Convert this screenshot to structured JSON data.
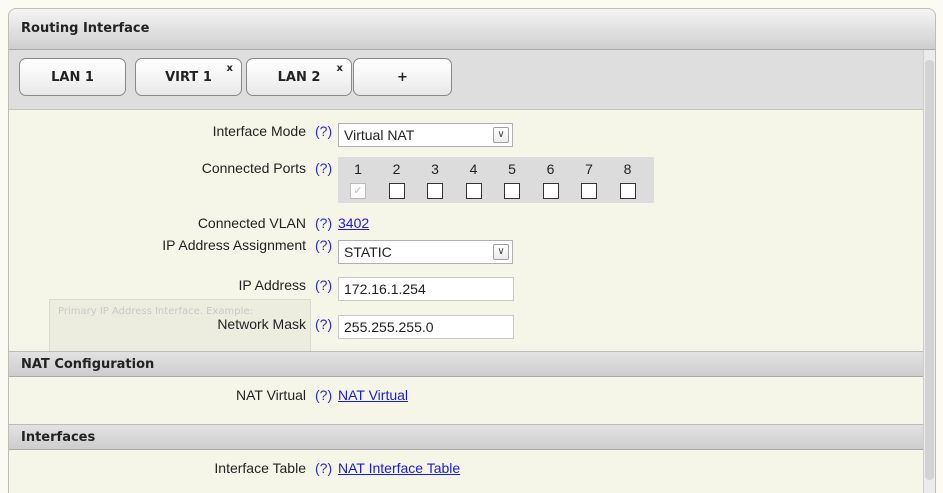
{
  "panel": {
    "title": "Routing Interface"
  },
  "tabs": [
    {
      "label": "LAN 1",
      "close": ""
    },
    {
      "label": "VIRT 1",
      "close": "x"
    },
    {
      "label": "LAN 2",
      "close": "x"
    },
    {
      "label": "+",
      "close": ""
    }
  ],
  "form": {
    "help": "(?)",
    "interface_mode": {
      "label": "Interface Mode",
      "value": "Virtual NAT",
      "arrow": "∨"
    },
    "connected_ports": {
      "label": "Connected Ports",
      "ports": [
        {
          "num": "1",
          "checked": true
        },
        {
          "num": "2",
          "checked": false
        },
        {
          "num": "3",
          "checked": false
        },
        {
          "num": "4",
          "checked": false
        },
        {
          "num": "5",
          "checked": false
        },
        {
          "num": "6",
          "checked": false
        },
        {
          "num": "7",
          "checked": false
        },
        {
          "num": "8",
          "checked": false
        }
      ]
    },
    "connected_vlan": {
      "label": "Connected VLAN",
      "value": "3402"
    },
    "ip_assignment": {
      "label": "IP Address Assignment",
      "value": "STATIC",
      "arrow": "∨"
    },
    "ip_address": {
      "label": "IP Address",
      "value": "172.16.1.254"
    },
    "network_mask": {
      "label": "Network Mask",
      "value": "255.255.255.0"
    },
    "tooltip_ghost": "Primary IP Address Interface. Example:"
  },
  "nat": {
    "section": "NAT Configuration",
    "label": "NAT Virtual",
    "link": "NAT Virtual"
  },
  "interfaces": {
    "section": "Interfaces",
    "label": "Interface Table",
    "link": "NAT Interface Table"
  }
}
